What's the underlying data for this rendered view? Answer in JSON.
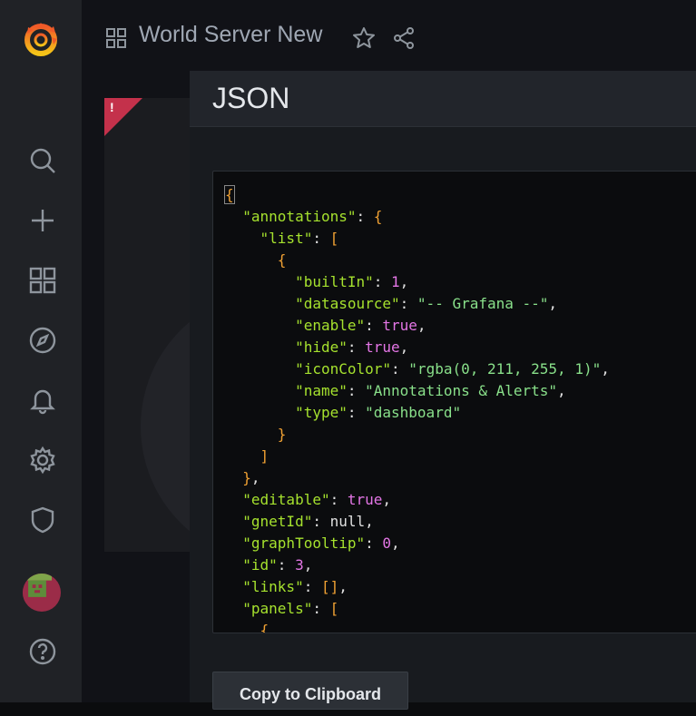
{
  "app": {
    "dashboard_title": "World Server New"
  },
  "sidebar": {
    "items": [
      {
        "icon": "search-icon"
      },
      {
        "icon": "plus-icon"
      },
      {
        "icon": "dashboards-icon"
      },
      {
        "icon": "explore-icon"
      },
      {
        "icon": "bell-icon"
      },
      {
        "icon": "gear-icon"
      },
      {
        "icon": "shield-icon"
      },
      {
        "icon": "help-icon"
      }
    ]
  },
  "alert_badge": {
    "symbol": "!"
  },
  "modal": {
    "title": "JSON",
    "copy_label": "Copy to Clipboard",
    "json_lines": [
      "{",
      "  \"annotations\": {",
      "    \"list\": [",
      "      {",
      "        \"builtIn\": 1,",
      "        \"datasource\": \"-- Grafana --\",",
      "        \"enable\": true,",
      "        \"hide\": true,",
      "        \"iconColor\": \"rgba(0, 211, 255, 1)\",",
      "        \"name\": \"Annotations & Alerts\",",
      "        \"type\": \"dashboard\"",
      "      }",
      "    ]",
      "  },",
      "  \"editable\": true,",
      "  \"gnetId\": null,",
      "  \"graphTooltip\": 0,",
      "  \"id\": 3,",
      "  \"links\": [],",
      "  \"panels\": [",
      "    {"
    ]
  },
  "colors": {
    "accent_orange": "#f0a133",
    "key_green": "#a6e22e",
    "string_green": "#89e08a",
    "value_magenta": "#e476e6",
    "alert_red": "#c4314b"
  }
}
